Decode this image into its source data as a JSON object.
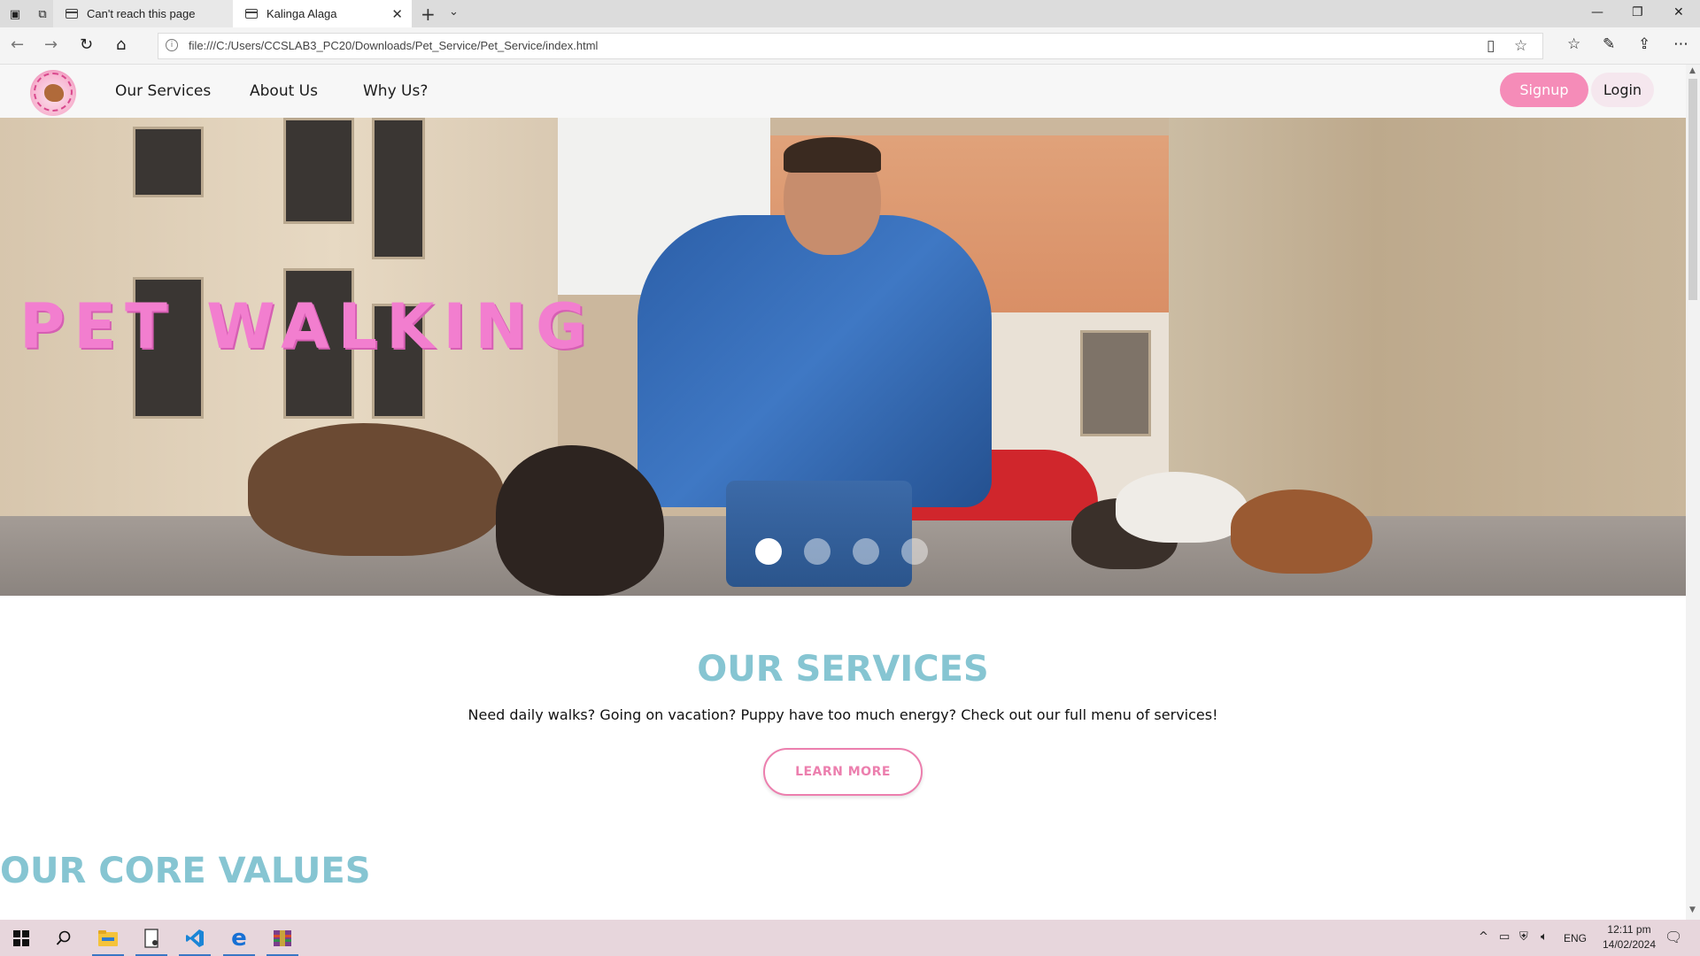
{
  "browser": {
    "tabs": [
      {
        "title": "Can't reach this page",
        "active": false
      },
      {
        "title": "Kalinga Alaga",
        "active": true
      }
    ],
    "tab_close": "✕",
    "new_tab": "+",
    "tab_list": "⌄",
    "window_controls": {
      "minimize": "—",
      "restore": "❐",
      "close": "✕"
    },
    "nav": {
      "back": "←",
      "forward": "→",
      "refresh": "↻",
      "home": "⌂"
    },
    "url": "file:///C:/Users/CCSLAB3_PC20/Downloads/Pet_Service/Pet_Service/index.html",
    "url_info": "i",
    "reading_view": "▯",
    "favorite": "☆",
    "toolbar": {
      "favorites": "☆",
      "notes": "✎",
      "share": "⇪",
      "more": "⋯"
    }
  },
  "site": {
    "nav": {
      "links": [
        "Our Services",
        "About Us",
        "Why Us?"
      ],
      "signup": "Signup",
      "login": "Login"
    },
    "hero": {
      "title": "PET WALKING",
      "slides": 4,
      "active_slide": 0
    },
    "services": {
      "title": "OUR SERVICES",
      "text": "Need daily walks? Going on vacation? Puppy have too much energy? Check out our full menu of services!",
      "button": "LEARN MORE"
    },
    "core_values": {
      "title": "OUR CORE VALUES"
    },
    "colors": {
      "accent_pink": "#f58cb8",
      "heading_teal": "#86c5d2",
      "hero_title_pink": "#f27ecf"
    }
  },
  "taskbar": {
    "apps": [
      "start-icon",
      "search-icon",
      "file-explorer-icon",
      "notepad-icon",
      "vscode-icon",
      "edge-icon",
      "winrar-icon"
    ],
    "tray": {
      "caret": "^",
      "language": "ENG",
      "time": "12:11 pm",
      "date": "14/02/2024"
    }
  }
}
